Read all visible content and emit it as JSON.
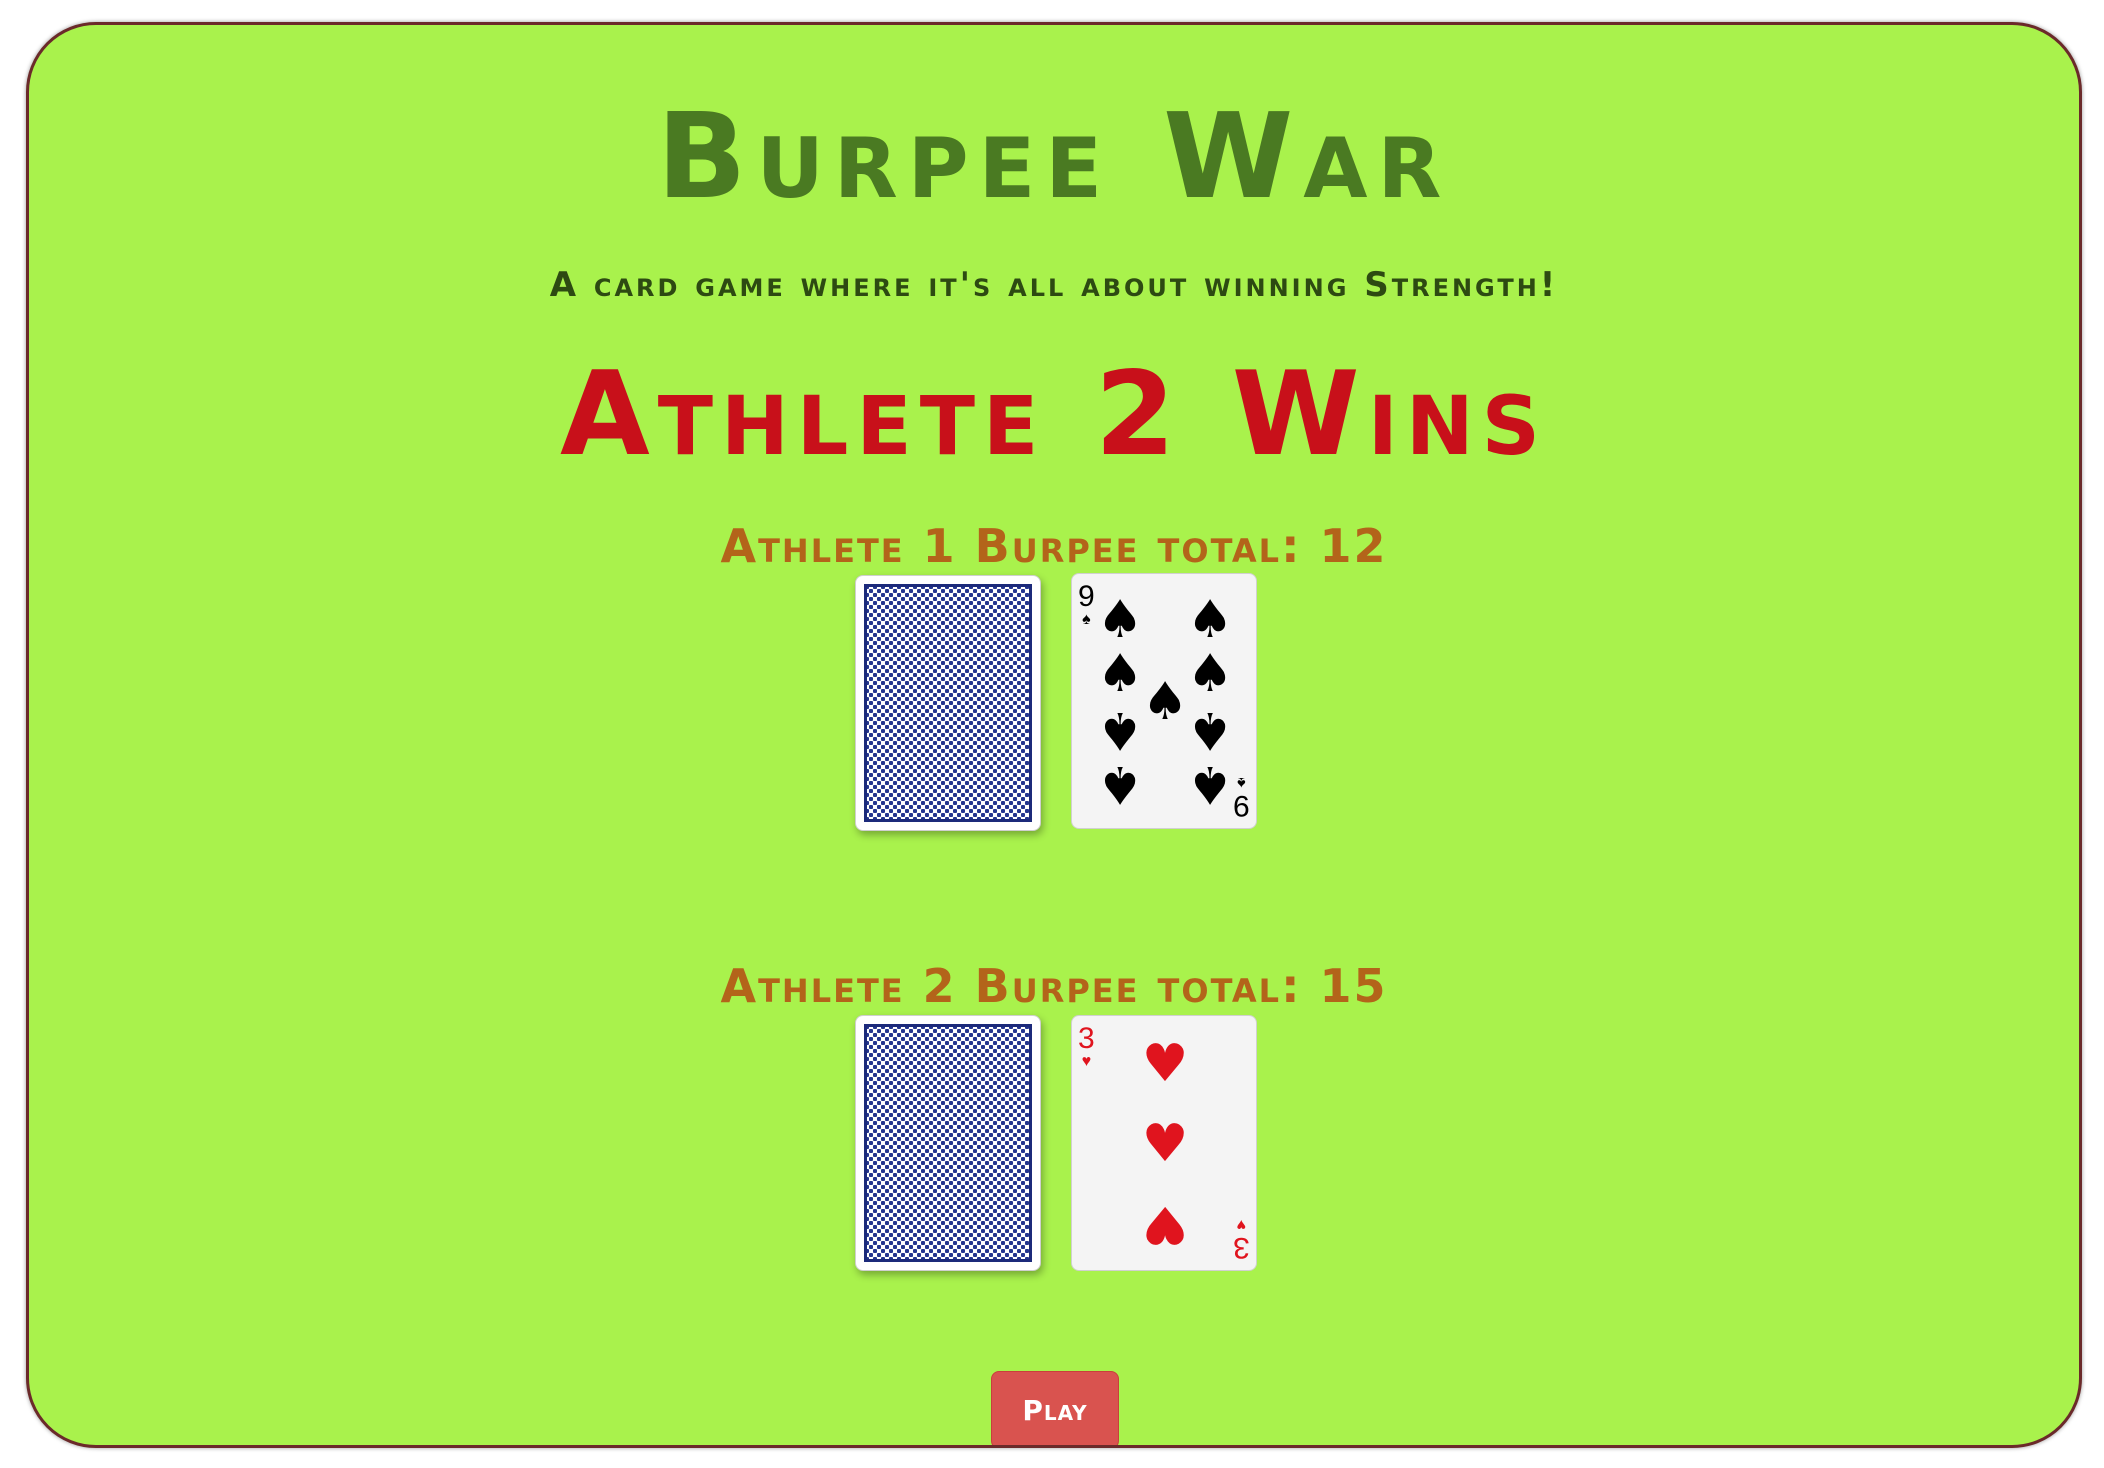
{
  "header": {
    "title": "Burpee War",
    "subtitle": "A card game where it's all about winning Strength!"
  },
  "result": {
    "winner_text": "Athlete 2 Wins"
  },
  "athlete1": {
    "total_label": "Athlete 1 Burpee total: 12",
    "face_card": {
      "rank": "9",
      "suit": "spades",
      "suit_symbol": "♠",
      "color": "#000000"
    },
    "back_card": {
      "pattern": "blue-diamond-back"
    }
  },
  "athlete2": {
    "total_label": "Athlete 2 Burpee total: 15",
    "face_card": {
      "rank": "3",
      "suit": "hearts",
      "suit_symbol": "♥",
      "color": "#e0141e"
    },
    "back_card": {
      "pattern": "blue-diamond-back"
    }
  },
  "controls": {
    "play_label": "Play"
  },
  "colors": {
    "board_background": "#a9f24c",
    "board_border": "#6b2a2a",
    "title": "#4a7a22",
    "subtitle": "#2d4a12",
    "winner": "#c8101a",
    "totals": "#b3641a",
    "play_button": "#d9534f"
  }
}
